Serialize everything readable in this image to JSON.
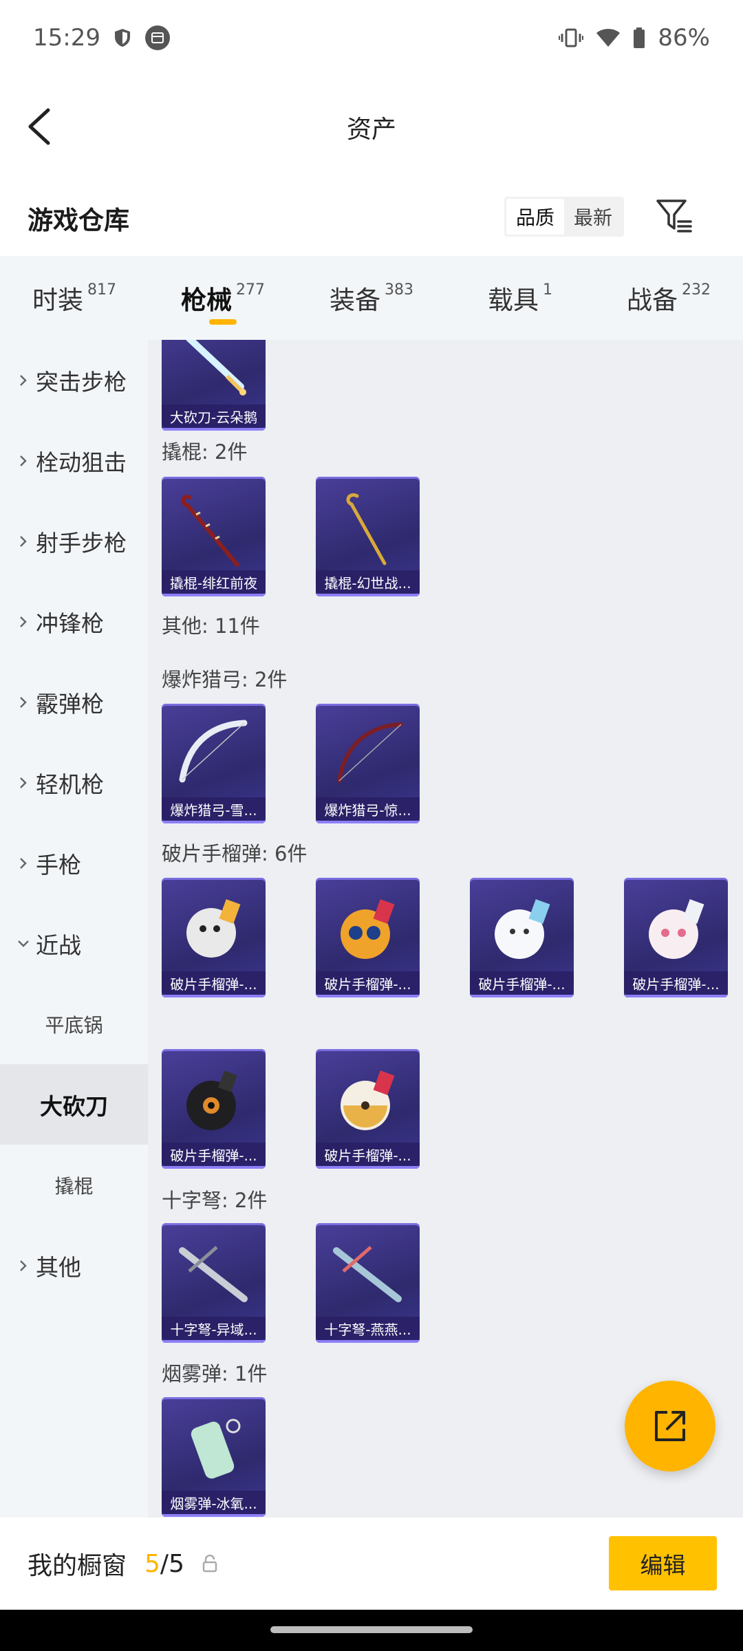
{
  "status_bar": {
    "time": "15:29",
    "battery": "86%"
  },
  "app_bar": {
    "title": "资产"
  },
  "warehouse": {
    "title": "游戏仓库",
    "sort_options": [
      "品质",
      "最新"
    ],
    "active_sort": "品质"
  },
  "tabs": [
    {
      "label": "时装",
      "count": "817"
    },
    {
      "label": "枪械",
      "count": "277",
      "active": true
    },
    {
      "label": "装备",
      "count": "383"
    },
    {
      "label": "载具",
      "count": "1"
    },
    {
      "label": "战备",
      "count": "232"
    }
  ],
  "sidebar": {
    "items": [
      "突击步枪",
      "栓动狙击",
      "射手步枪",
      "冲锋枪",
      "霰弹枪",
      "轻机枪",
      "手枪",
      "近战"
    ],
    "sub_items": [
      "平底锅",
      "大砍刀",
      "撬棍"
    ],
    "active_sub": "大砍刀",
    "last_item": "其他"
  },
  "content": {
    "top_card": "大砍刀-云朵鹅",
    "groups": {
      "crowbar": {
        "label": "撬棍: 2件",
        "cards": [
          "撬棍-绯红前夜",
          "撬棍-幻世战..."
        ]
      },
      "other": {
        "label": "其他: 11件"
      },
      "bow": {
        "label": "爆炸猎弓: 2件",
        "cards": [
          "爆炸猎弓-雪...",
          "爆炸猎弓-惊..."
        ]
      },
      "grenade": {
        "label": "破片手榴弹: 6件",
        "cards": [
          "破片手榴弹-...",
          "破片手榴弹-...",
          "破片手榴弹-...",
          "破片手榴弹-...",
          "破片手榴弹-...",
          "破片手榴弹-..."
        ]
      },
      "crossbow": {
        "label": "十字弩: 2件",
        "cards": [
          "十字弩-异域...",
          "十字弩-燕燕..."
        ]
      },
      "smoke": {
        "label": "烟雾弹: 1件",
        "cards": [
          "烟雾弹-冰氧..."
        ]
      }
    }
  },
  "bottom_bar": {
    "label": "我的橱窗",
    "current": "5",
    "separator": "/",
    "total": "5",
    "edit_label": "编辑"
  },
  "colors": {
    "accent": "#ffb400",
    "card_bg": "#3a3384",
    "page_bg": "#edeff3"
  }
}
